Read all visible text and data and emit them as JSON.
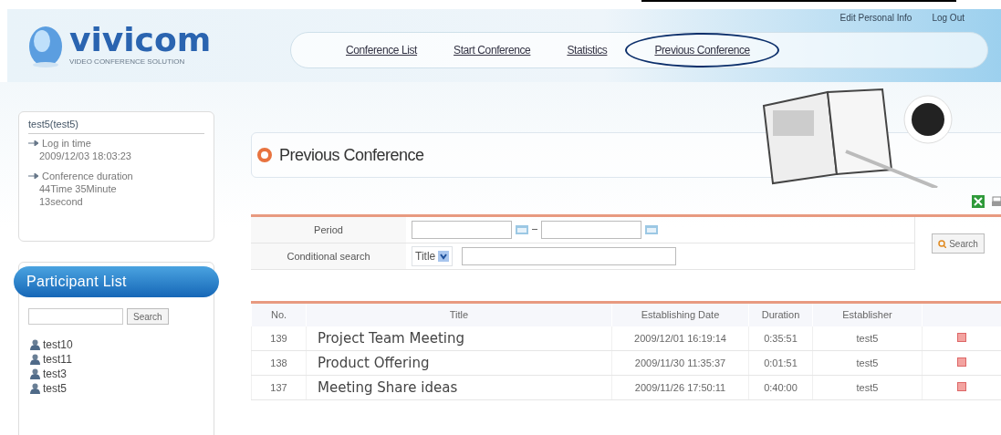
{
  "header": {
    "logo": "vivicom",
    "tagline": "VIDEO CONFERENCE SOLUTION",
    "top_links": [
      "Edit Personal Info",
      "Log Out"
    ],
    "nav": [
      {
        "label": "Conference List",
        "selected": false
      },
      {
        "label": "Start Conference",
        "selected": false
      },
      {
        "label": "Statistics",
        "selected": false
      },
      {
        "label": "Previous Conference",
        "selected": true
      }
    ]
  },
  "user_box": {
    "user": "test5(test5)",
    "login_label": "Log in time",
    "login_time": "2009/12/03 18:03:23",
    "duration_label": "Conference duration",
    "duration_value": "44Time 35Minute 13second"
  },
  "participants": {
    "title": "Participant List",
    "search_button": "Search",
    "items": [
      "test10",
      "test11",
      "test3",
      "test5"
    ]
  },
  "page_title": "Previous Conference",
  "filter": {
    "period_label": "Period",
    "conditional_label": "Conditional search",
    "select_value": "Title",
    "search_button": "Search"
  },
  "table": {
    "columns": [
      "No.",
      "Title",
      "Establishing Date",
      "Duration",
      "Establisher"
    ],
    "rows": [
      {
        "no": "139",
        "title": "Project Team Meeting",
        "date": "2009/12/01 16:19:14",
        "duration": "0:35:51",
        "establisher": "test5"
      },
      {
        "no": "138",
        "title": "Product Offering",
        "date": "2009/11/30 11:35:37",
        "duration": "0:01:51",
        "establisher": "test5"
      },
      {
        "no": "137",
        "title": "Meeting Share ideas",
        "date": "2009/11/26 17:50:11",
        "duration": "0:40:00",
        "establisher": "test5"
      }
    ]
  }
}
